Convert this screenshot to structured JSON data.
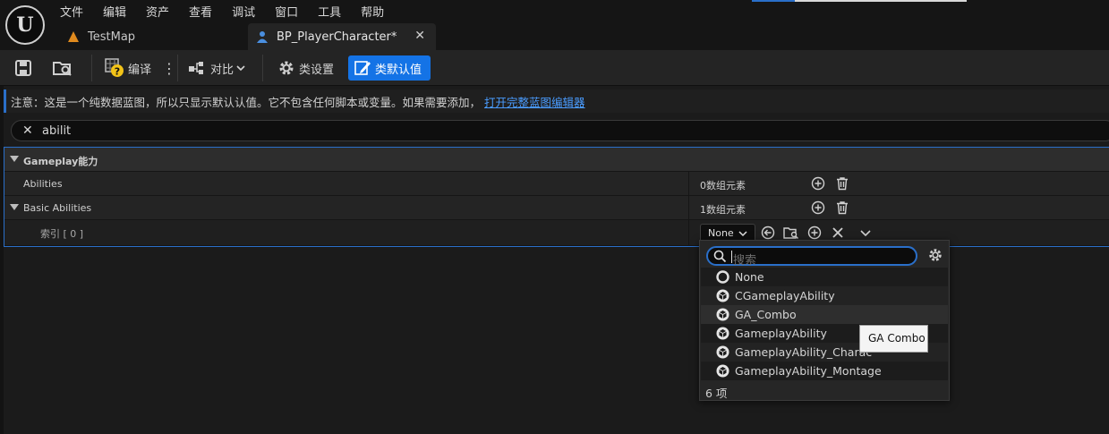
{
  "menu": {
    "items": [
      "文件",
      "编辑",
      "资产",
      "查看",
      "调试",
      "窗口",
      "工具",
      "帮助"
    ]
  },
  "tabs": [
    {
      "label": "TestMap",
      "icon": "level-icon"
    },
    {
      "label": "BP_PlayerCharacter*",
      "icon": "character-icon",
      "active": true
    }
  ],
  "toolbar": {
    "compile_label": "编译",
    "diff_label": "对比",
    "class_settings_label": "类设置",
    "class_defaults_label": "类默认值"
  },
  "notice": {
    "text": "注意：这是一个纯数据蓝图，所以只显示默认认值。它不包含任何脚本或变量。如果需要添加，",
    "link": "打开完整蓝图编辑器"
  },
  "search": {
    "value": "abilit"
  },
  "details": {
    "category": "Gameplay能力",
    "rows": [
      {
        "label": "Abilities",
        "value": "0数组元素"
      },
      {
        "label": "Basic Abilities",
        "value": "1数组元素"
      },
      {
        "label": "索引 [ 0 ]",
        "value": "None"
      }
    ]
  },
  "popup": {
    "search_placeholder": "搜索",
    "items": [
      "None",
      "CGameplayAbility",
      "GA_Combo",
      "GameplayAbility",
      "GameplayAbility_Charac",
      "GameplayAbility_Montage"
    ],
    "count": "6 项"
  },
  "tooltip": {
    "text": "GA Combo"
  },
  "colors": {
    "accent": "#1473e6",
    "selection_border": "#2a6fc9",
    "link": "#4a9cff"
  }
}
